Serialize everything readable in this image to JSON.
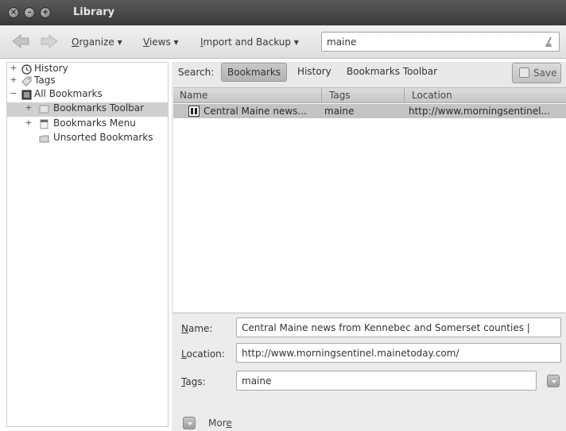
{
  "window": {
    "title": "Library"
  },
  "toolbar": {
    "organize": {
      "mnemonic": "O",
      "rest": "rganize ▾"
    },
    "views": {
      "mnemonic": "V",
      "rest": "iews ▾"
    },
    "import_backup": {
      "mnemonic": "I",
      "rest": "mport and Backup ▾"
    },
    "search_value": "maine"
  },
  "sidebar": {
    "items": [
      {
        "label": "History",
        "expander": "+"
      },
      {
        "label": "Tags",
        "expander": "+"
      },
      {
        "label": "All Bookmarks",
        "expander": "−"
      },
      {
        "label": "Bookmarks Toolbar",
        "expander": "+"
      },
      {
        "label": "Bookmarks Menu",
        "expander": "+"
      },
      {
        "label": "Unsorted Bookmarks",
        "expander": ""
      }
    ]
  },
  "search_scope": {
    "label": "Search:",
    "bookmarks": "Bookmarks",
    "history": "History",
    "toolbar": "Bookmarks Toolbar",
    "save": "Save"
  },
  "list": {
    "columns": [
      "Name",
      "Tags",
      "Location"
    ],
    "rows": [
      {
        "name": "Central Maine news...",
        "tags": "maine",
        "location": "http://www.morningsentinel..."
      }
    ]
  },
  "details": {
    "name_label": "Name:",
    "name_value": "Central Maine news from Kennebec and Somerset counties |",
    "location_label": "Location:",
    "location_value": "http://www.morningsentinel.mainetoday.com/",
    "tags_label": "Tags:",
    "tags_value": "maine",
    "more_label": "More"
  }
}
